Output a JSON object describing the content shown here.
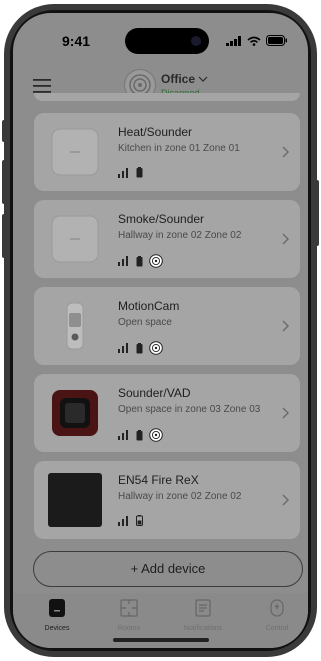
{
  "status_bar": {
    "time": "9:41"
  },
  "header": {
    "hub_name": "Office",
    "hub_status": "Disarmed"
  },
  "devices": [
    {
      "name": "Heat/Sounder",
      "room": "Kitchen in zone 01 Zone 01",
      "fire_badge": false,
      "image": "white-square-detector"
    },
    {
      "name": "Smoke/Sounder",
      "room": "Hallway in zone 02 Zone 02",
      "fire_badge": true,
      "image": "white-square-detector"
    },
    {
      "name": "MotionCam",
      "room": "Open space",
      "fire_badge": true,
      "image": "motion-camera"
    },
    {
      "name": "Sounder/VAD",
      "room": "Open space in zone 03 Zone 03",
      "fire_badge": true,
      "image": "red-sounder"
    },
    {
      "name": "EN54 Fire ReX",
      "room": "Hallway in zone 02 Zone 02",
      "fire_badge": false,
      "image": "black-box"
    }
  ],
  "add_device_label": "+ Add device",
  "tabs": [
    {
      "label": "Devices",
      "icon": "devices-icon",
      "active": true
    },
    {
      "label": "Rooms",
      "icon": "rooms-icon",
      "active": false
    },
    {
      "label": "Notifications",
      "icon": "notifications-icon",
      "active": false
    },
    {
      "label": "Control",
      "icon": "control-icon",
      "active": false
    }
  ],
  "colors": {
    "overlay": "#8d8d8d",
    "card": "#a5a5a5",
    "status_green": "#2f6b35"
  }
}
